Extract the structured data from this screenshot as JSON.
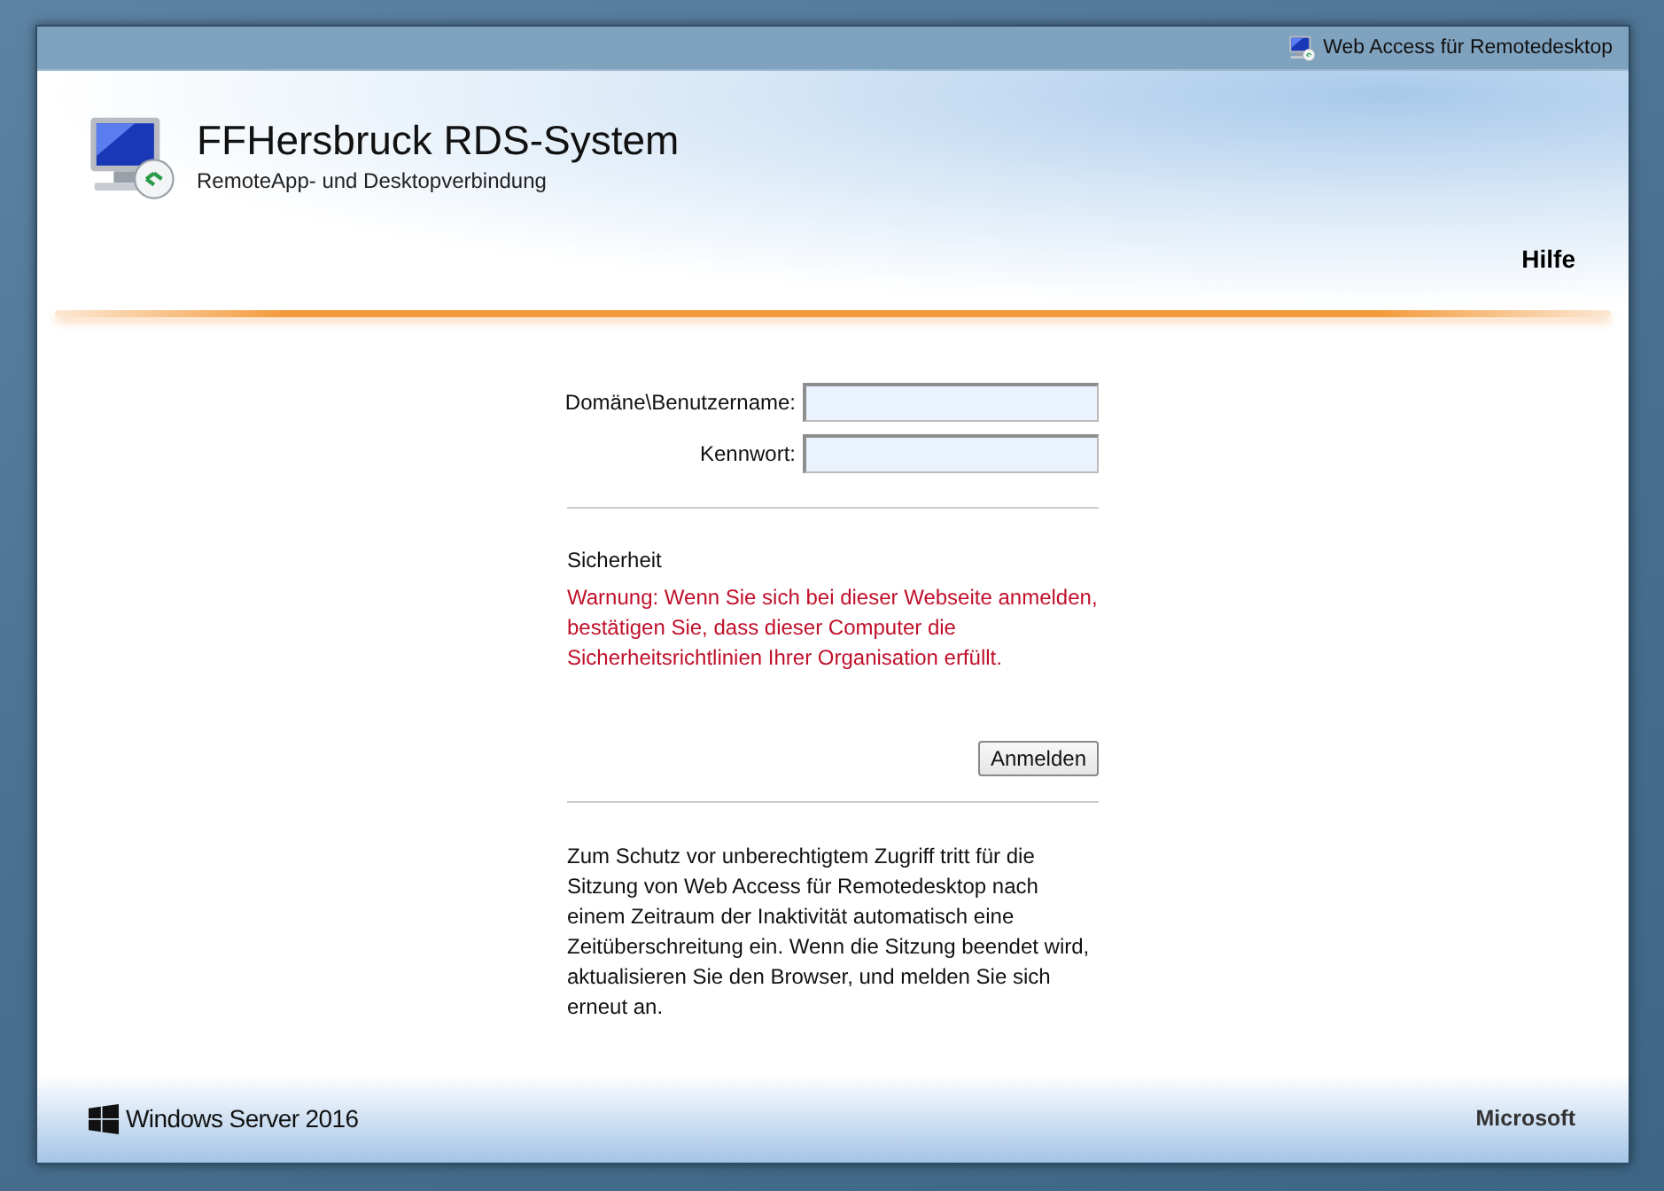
{
  "top_bar": {
    "label": "Web Access für Remotedesktop"
  },
  "header": {
    "title": "FFHersbruck RDS-System",
    "subtitle": "RemoteApp- und Desktopverbindung",
    "nav": [
      "Hilfe"
    ]
  },
  "form": {
    "fields": [
      {
        "label": "Domäne\\Benutzername:"
      },
      {
        "label": "Kennwort:"
      }
    ],
    "security_title": "Sicherheit",
    "warning": "Warnung: Wenn Sie sich bei dieser Webseite anmelden, bestätigen Sie, dass dieser Computer die Sicherheitsrichtlinien Ihrer Organisation erfüllt.",
    "submit": "Anmelden",
    "notice": "Zum Schutz vor unberechtigtem Zugriff tritt für die Sitzung von Web Access für Remotedesktop nach einem Zeitraum der Inaktivität automatisch eine Zeitüberschreitung ein. Wenn die Sitzung beendet wird, aktualisieren Sie den Browser, und melden Sie sich erneut an."
  },
  "footer": {
    "product": "Windows Server 2016",
    "vendor": "Microsoft"
  }
}
